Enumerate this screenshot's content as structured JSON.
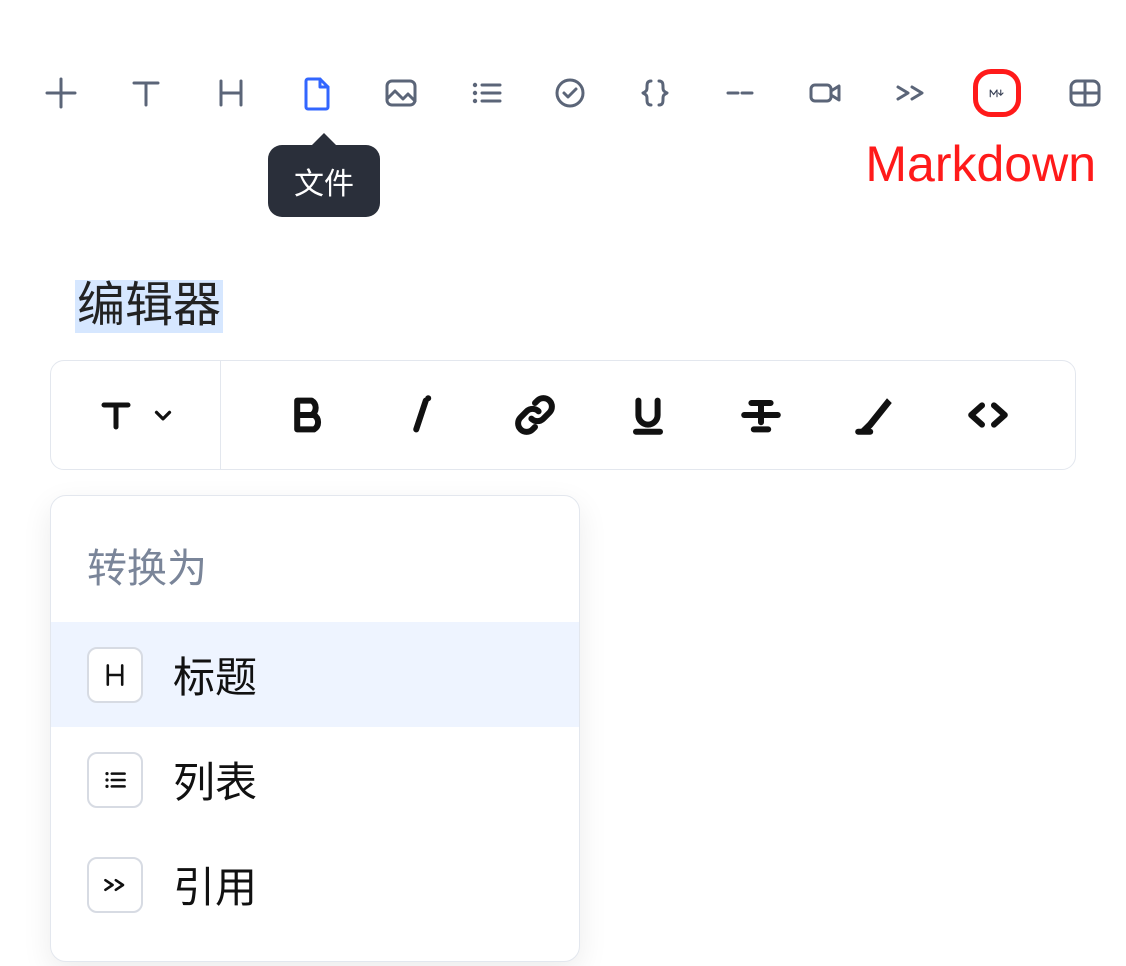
{
  "toolbar": {
    "items": [
      {
        "name": "add",
        "icon": "plus-icon",
        "active": false
      },
      {
        "name": "text",
        "icon": "text-icon",
        "active": false
      },
      {
        "name": "heading",
        "icon": "heading-icon",
        "active": false
      },
      {
        "name": "file",
        "icon": "file-icon",
        "active": true
      },
      {
        "name": "image",
        "icon": "image-icon",
        "active": false
      },
      {
        "name": "list",
        "icon": "list-icon",
        "active": false
      },
      {
        "name": "task",
        "icon": "check-circle-icon",
        "active": false
      },
      {
        "name": "code",
        "icon": "braces-icon",
        "active": false
      },
      {
        "name": "divider",
        "icon": "dash-icon",
        "active": false
      },
      {
        "name": "video",
        "icon": "video-icon",
        "active": false
      },
      {
        "name": "quote",
        "icon": "quote-icon",
        "active": false
      },
      {
        "name": "markdown",
        "icon": "markdown-icon",
        "active": false,
        "highlighted": true
      },
      {
        "name": "table",
        "icon": "table-icon",
        "active": false
      }
    ]
  },
  "tooltip": {
    "label": "文件"
  },
  "annotation": {
    "label": "Markdown",
    "target": "markdown"
  },
  "editor": {
    "selected_text": "编辑器"
  },
  "inline_toolbar": {
    "type_button": {
      "icon": "text-icon",
      "chevron": "chevron-down-icon"
    },
    "buttons": [
      {
        "name": "bold",
        "icon": "bold-icon"
      },
      {
        "name": "italic",
        "icon": "italic-icon"
      },
      {
        "name": "link",
        "icon": "link-icon"
      },
      {
        "name": "underline",
        "icon": "underline-icon"
      },
      {
        "name": "strikethrough",
        "icon": "strikethrough-icon"
      },
      {
        "name": "highlight",
        "icon": "highlight-icon"
      },
      {
        "name": "code",
        "icon": "code-icon"
      }
    ]
  },
  "popup": {
    "title": "转换为",
    "items": [
      {
        "label": "标题",
        "icon": "heading-icon",
        "hover": true
      },
      {
        "label": "列表",
        "icon": "list-icon",
        "hover": false
      },
      {
        "label": "引用",
        "icon": "quote-icon",
        "hover": false
      }
    ]
  },
  "colors": {
    "icon_default": "#5b6578",
    "icon_active": "#3266ff",
    "annotation_red": "#ff1a1a",
    "tooltip_bg": "#2a2f3a",
    "popup_hover": "#eef4ff",
    "selection_bg": "#d6e7ff"
  }
}
